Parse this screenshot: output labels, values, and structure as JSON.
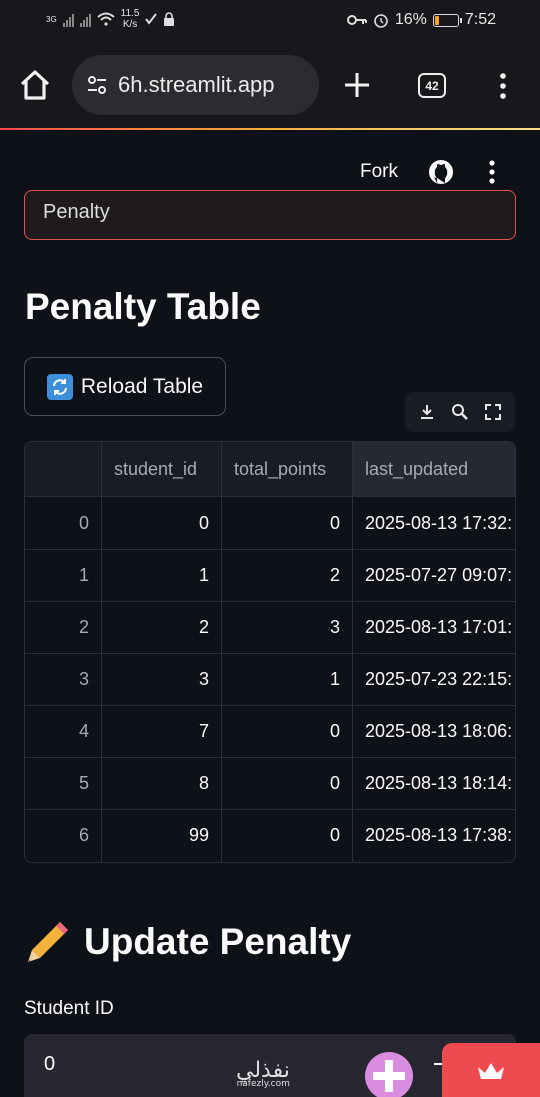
{
  "status_bar": {
    "network_label": "3G",
    "speed_value": "11.5",
    "speed_unit": "K/s",
    "battery_text": "16%",
    "battery_level": 0.16,
    "time": "7:52"
  },
  "browser": {
    "url": "6h.streamlit.app",
    "tab_count": "42"
  },
  "app_header": {
    "fork_label": "Fork"
  },
  "clipped_alert": {
    "text": "Penalty"
  },
  "penalty_section": {
    "title": "Penalty Table",
    "reload_label": "Reload Table",
    "reload_icon": "counterclockwise-arrows-icon"
  },
  "table": {
    "columns": [
      "",
      "student_id",
      "total_points",
      "last_updated"
    ],
    "rows": [
      [
        "0",
        "0",
        "0",
        "2025-08-13 17:32:"
      ],
      [
        "1",
        "1",
        "2",
        "2025-07-27 09:07:"
      ],
      [
        "2",
        "2",
        "3",
        "2025-08-13 17:01:"
      ],
      [
        "3",
        "3",
        "1",
        "2025-07-23 22:15:"
      ],
      [
        "4",
        "7",
        "0",
        "2025-08-13 18:06:"
      ],
      [
        "5",
        "8",
        "0",
        "2025-08-13 18:14:"
      ],
      [
        "6",
        "99",
        "0",
        "2025-08-13 17:38:"
      ]
    ]
  },
  "update_section": {
    "title": "Update Penalty",
    "icon": "pencil-icon",
    "student_id_label": "Student ID",
    "student_id_value": "0"
  },
  "watermark": {
    "text": "نفذلي",
    "subtext": "nafezly.com"
  },
  "colors": {
    "background": "#0e1117",
    "accent_red": "#ff4b4b",
    "badge_red": "#ef4a4f"
  }
}
